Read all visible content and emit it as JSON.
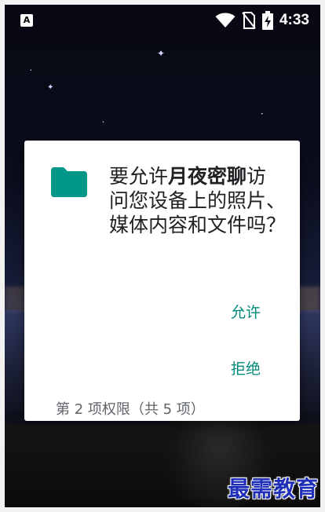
{
  "status_bar": {
    "time": "4:33",
    "left_icon": "A",
    "icons": [
      "wifi-icon",
      "no-sim-icon",
      "battery-charging-icon"
    ]
  },
  "dialog": {
    "title_prefix": "要允许",
    "app_name": "月夜密聊",
    "title_suffix": "访问您设备上的照片、媒体内容和文件吗？",
    "allow_label": "允许",
    "deny_label": "拒绝",
    "permission_count": "第 2 项权限（共 5 项）",
    "icon": "folder-icon",
    "accent_color": "#00897b",
    "icon_color": "#009688"
  },
  "watermark": {
    "text": "最需教育"
  }
}
